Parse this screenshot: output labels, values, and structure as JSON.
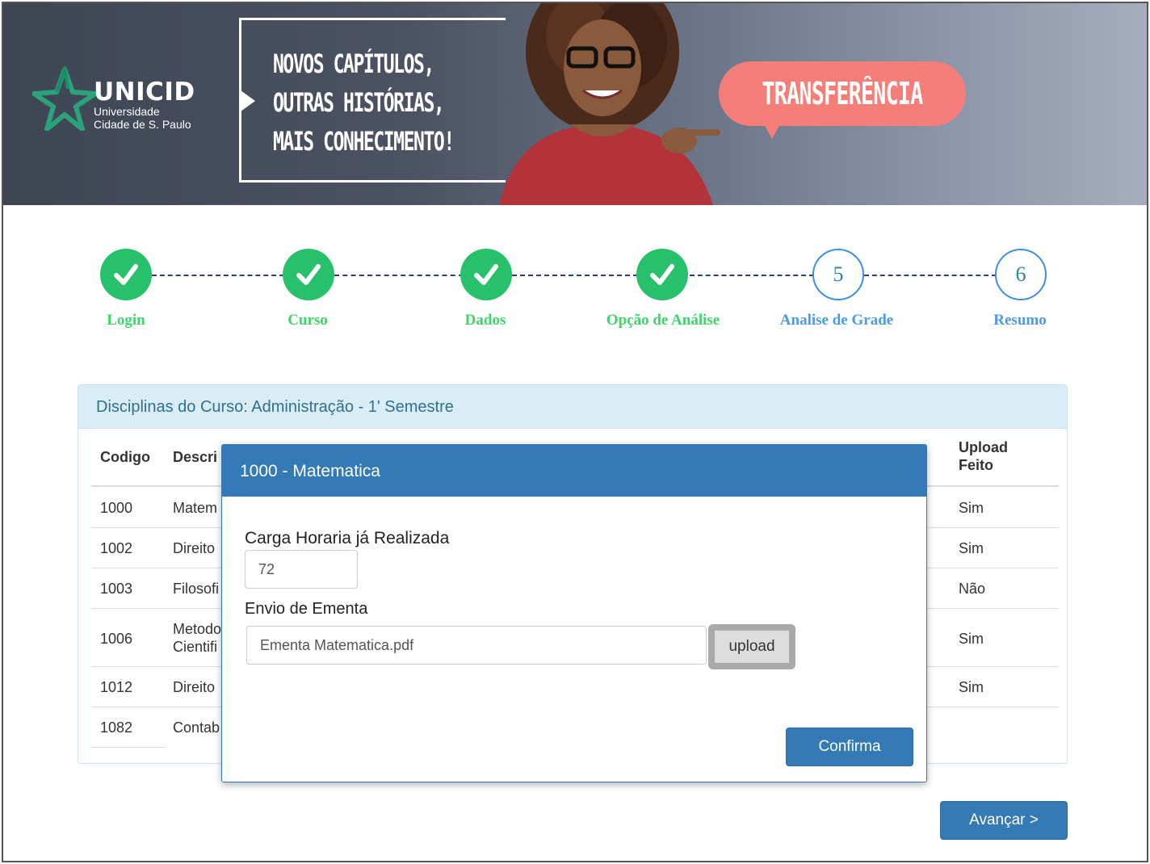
{
  "banner": {
    "logo_name": "UNICID",
    "logo_sub1": "Universidade",
    "logo_sub2": "Cidade de S. Paulo",
    "slogan": [
      "NOVOS CAPÍTULOS,",
      "OUTRAS HISTÓRIAS,",
      "MAIS CONHECIMENTO!"
    ],
    "bubble_text": "TRANSFERÊNCIA",
    "colors": {
      "bubble": "#f57e78",
      "logo_green": "#2aa37a"
    }
  },
  "stepper": {
    "steps": [
      {
        "label": "Login",
        "state": "done"
      },
      {
        "label": "Curso",
        "state": "done"
      },
      {
        "label": "Dados",
        "state": "done"
      },
      {
        "label": "Opção de Análise",
        "state": "done"
      },
      {
        "label": "Analise de Grade",
        "state": "current",
        "number": "5"
      },
      {
        "label": "Resumo",
        "state": "todo",
        "number": "6"
      }
    ],
    "colors": {
      "done": "#27c16c",
      "todo": "#4a9ce8"
    }
  },
  "panel": {
    "title": "Disciplinas do Curso: Administração - 1' Semestre",
    "columns": {
      "codigo": "Codigo",
      "descricao": "Descri",
      "upload_line1": "Upload",
      "upload_line2": "Feito"
    },
    "rows": [
      {
        "codigo": "1000",
        "descricao": "Matem",
        "upload": "Sim"
      },
      {
        "codigo": "1002",
        "descricao": "Direito",
        "upload": "Sim"
      },
      {
        "codigo": "1003",
        "descricao": "Filosofi",
        "upload": "Não"
      },
      {
        "codigo": "1006",
        "descricao": "Metodo",
        "descricao2": "Cientifi",
        "upload": "Sim"
      },
      {
        "codigo": "1012",
        "descricao": "Direito",
        "upload": "Sim"
      },
      {
        "codigo": "1082",
        "descricao": "Contab",
        "upload": ""
      }
    ]
  },
  "modal": {
    "title": "1000 - Matematica",
    "carga_label": "Carga Horaria já Realizada",
    "carga_value": "72",
    "ementa_label": "Envio de Ementa",
    "ementa_value": "Ementa Matematica.pdf",
    "upload_label": "upload",
    "confirm_label": "Confirma"
  },
  "footer": {
    "next_label": "Avançar >"
  }
}
